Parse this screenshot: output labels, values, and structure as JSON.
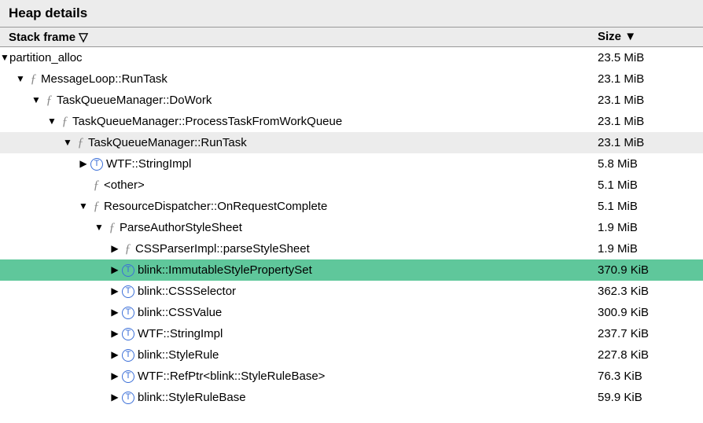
{
  "title": "Heap details",
  "columns": {
    "name": "Stack frame",
    "size": "Size"
  },
  "rows": [
    {
      "indent": 0,
      "arrow": "down",
      "icon": "",
      "name": "partition_alloc",
      "size": "23.5 MiB",
      "hl": ""
    },
    {
      "indent": 20,
      "arrow": "down",
      "icon": "f",
      "name": "MessageLoop::RunTask",
      "size": "23.1 MiB",
      "hl": ""
    },
    {
      "indent": 40,
      "arrow": "down",
      "icon": "f",
      "name": "TaskQueueManager::DoWork",
      "size": "23.1 MiB",
      "hl": ""
    },
    {
      "indent": 60,
      "arrow": "down",
      "icon": "f",
      "name": "TaskQueueManager::ProcessTaskFromWorkQueue",
      "size": "23.1 MiB",
      "hl": ""
    },
    {
      "indent": 80,
      "arrow": "down",
      "icon": "f",
      "name": "TaskQueueManager::RunTask",
      "size": "23.1 MiB",
      "hl": "grey"
    },
    {
      "indent": 100,
      "arrow": "right",
      "icon": "t",
      "name": "WTF::StringImpl",
      "size": "5.8 MiB",
      "hl": ""
    },
    {
      "indent": 100,
      "arrow": "blank",
      "icon": "f",
      "name": "<other>",
      "size": "5.1 MiB",
      "hl": ""
    },
    {
      "indent": 100,
      "arrow": "down",
      "icon": "f",
      "name": "ResourceDispatcher::OnRequestComplete",
      "size": "5.1 MiB",
      "hl": ""
    },
    {
      "indent": 120,
      "arrow": "down",
      "icon": "f",
      "name": "ParseAuthorStyleSheet",
      "size": "1.9 MiB",
      "hl": ""
    },
    {
      "indent": 140,
      "arrow": "right",
      "icon": "f",
      "name": "CSSParserImpl::parseStyleSheet",
      "size": "1.9 MiB",
      "hl": ""
    },
    {
      "indent": 140,
      "arrow": "right",
      "icon": "t",
      "name": "blink::ImmutableStylePropertySet",
      "size": "370.9 KiB",
      "hl": "green"
    },
    {
      "indent": 140,
      "arrow": "right",
      "icon": "t",
      "name": "blink::CSSSelector",
      "size": "362.3 KiB",
      "hl": ""
    },
    {
      "indent": 140,
      "arrow": "right",
      "icon": "t",
      "name": "blink::CSSValue",
      "size": "300.9 KiB",
      "hl": ""
    },
    {
      "indent": 140,
      "arrow": "right",
      "icon": "t",
      "name": "WTF::StringImpl",
      "size": "237.7 KiB",
      "hl": ""
    },
    {
      "indent": 140,
      "arrow": "right",
      "icon": "t",
      "name": "blink::StyleRule",
      "size": "227.8 KiB",
      "hl": ""
    },
    {
      "indent": 140,
      "arrow": "right",
      "icon": "t",
      "name": "WTF::RefPtr<blink::StyleRuleBase>",
      "size": "76.3 KiB",
      "hl": ""
    },
    {
      "indent": 140,
      "arrow": "right",
      "icon": "t",
      "name": "blink::StyleRuleBase",
      "size": "59.9 KiB",
      "hl": ""
    }
  ]
}
